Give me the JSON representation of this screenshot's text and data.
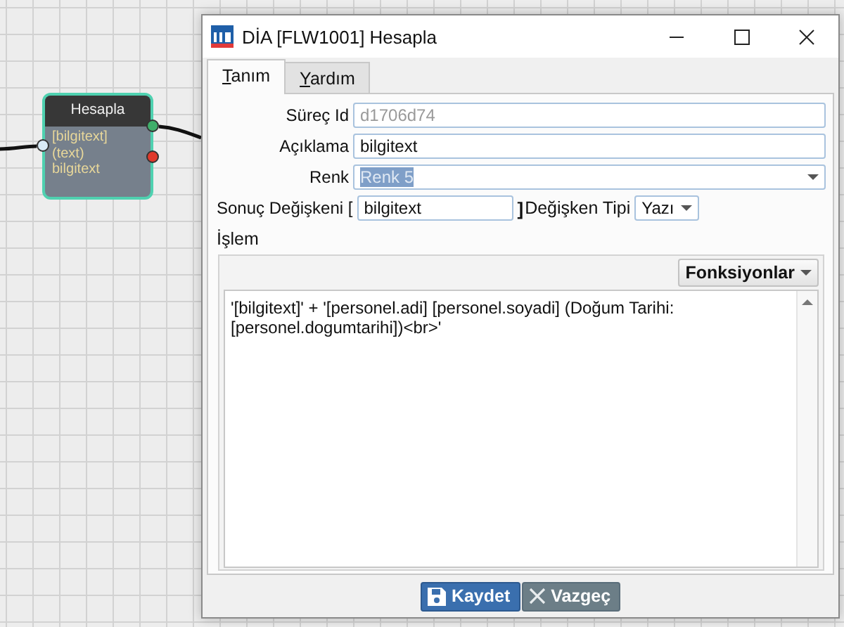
{
  "canvas": {
    "node": {
      "title": "Hesapla",
      "lines": [
        "[bilgitext]",
        "(text)",
        "bilgitext"
      ],
      "ports": [
        {
          "kind": "input",
          "color": "#d8eaf6"
        },
        {
          "kind": "output",
          "color": "#3fae6a"
        },
        {
          "kind": "output",
          "color": "#e0392b"
        }
      ]
    }
  },
  "dialog": {
    "title": "DİA [FLW1001] Hesapla",
    "tabs": [
      {
        "label": "Tanım",
        "selected": true
      },
      {
        "label": "Yardım",
        "selected": false
      }
    ],
    "fields": [
      {
        "kind": "text",
        "label": "Süreç Id",
        "value": "d1706d74",
        "disabled": true
      },
      {
        "kind": "text",
        "label": "Açıklama",
        "value": "bilgitext",
        "disabled": false
      },
      {
        "kind": "select",
        "label": "Renk",
        "value": "Renk 5",
        "highlighted": true
      }
    ],
    "result": {
      "label": "Sonuç Değişkeni [",
      "value": "bilgitext",
      "bracket": "]",
      "type_label": "Değişken Tipi",
      "type_value": "Yazı"
    },
    "islem": {
      "label": "İşlem",
      "functions_button": "Fonksiyonlar",
      "code": "'[bilgitext]' + '[personel.adi] [personel.soyadi] (Doğum Tarihi: [personel.dogumtarihi])<br>'"
    },
    "buttons": [
      {
        "kind": "save",
        "label": "Kaydet"
      },
      {
        "kind": "cancel",
        "label": "Vazgeç"
      }
    ]
  }
}
